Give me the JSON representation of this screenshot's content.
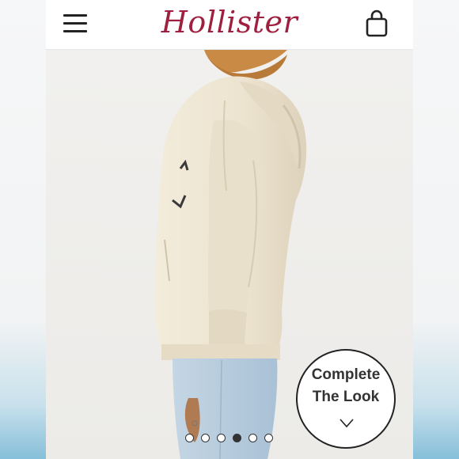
{
  "brand": {
    "logo_text": "Hollister",
    "logo_color": "#9e1f3e"
  },
  "header": {
    "menu_icon": "hamburger-menu-icon",
    "bag_icon": "shopping-bag-icon"
  },
  "product": {
    "image_description_icon": "product-photo",
    "complete_the_look": {
      "line1": "Complete",
      "line2": "The Look",
      "icon": "chevron-down-icon"
    }
  },
  "carousel": {
    "total": 6,
    "active_index": 3
  }
}
